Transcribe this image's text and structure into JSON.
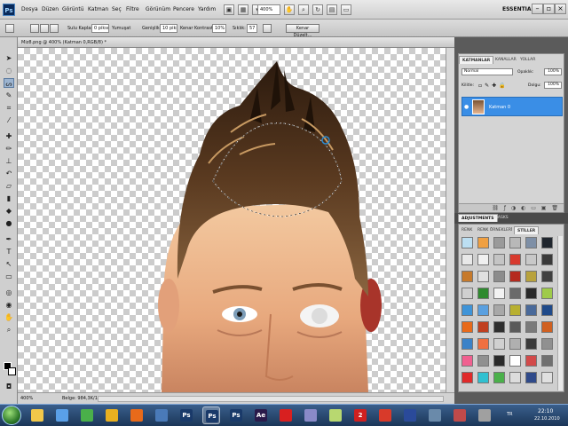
{
  "menubar": {
    "logo": "Ps",
    "items": [
      "Dosya",
      "Düzen",
      "Görüntü",
      "Katman",
      "Seç",
      "Filtre",
      "Görünüm",
      "Pencere",
      "Yardım"
    ],
    "zoom": "400%",
    "workspace": "ESSENTIALS"
  },
  "options": {
    "feather_label": "Sulu Kaplan:",
    "feather_value": "0 piksel",
    "antialias_label": "Yumuşat",
    "width_label": "Genişlik:",
    "width_value": "10 piksel",
    "contrast_label": "Kenar Kontrastı:",
    "contrast_value": "10%",
    "freq_label": "Sıklık:",
    "freq_value": "57",
    "refine_label": "Kenar Düzelt..."
  },
  "document": {
    "tab_title": "Miz8.png @ 400% (Katman 0,RGB/8) *",
    "zoom_status": "400%",
    "doc_size": "Belge: 984,3K/1,28M"
  },
  "layers": {
    "tabs": [
      "KATMANLAR",
      "KANALLAR",
      "YOLLAR"
    ],
    "blend_mode": "Normal",
    "opacity_label": "Opaklık:",
    "opacity_value": "100%",
    "lock_label": "Kilitle:",
    "fill_label": "Dolgu:",
    "fill_value": "100%",
    "layer_name": "Katman 0"
  },
  "adjustments": {
    "tabs": [
      "ADJUSTMENTS",
      "MASKS"
    ]
  },
  "styles": {
    "tabs": [
      "RENK",
      "RENK ÖRNEKLERİ",
      "STİLLER"
    ],
    "colors": [
      "#bcdff2",
      "#f0a042",
      "#9a9a9a",
      "#b8b8b8",
      "#7e8fa6",
      "#20262e",
      "#e8e8e8",
      "#f0f0f0",
      "#c4c4c4",
      "#d83a2e",
      "#c8c8c8",
      "#3a3a3a",
      "#c77a2b",
      "#e0e0e0",
      "#8c8c8c",
      "#b52a1e",
      "#b8a23c",
      "#404040",
      "#d0d0d0",
      "#2f8a2f",
      "#f2f2f2",
      "#6a6a6a",
      "#2a2a2a",
      "#9fcb4a",
      "#3f94d8",
      "#5aa0e0",
      "#a8a8a8",
      "#b8b030",
      "#4a6a9a",
      "#1f4a8a",
      "#e86a1a",
      "#c04020",
      "#2f2f2f",
      "#5a5a5a",
      "#7a7a7a",
      "#d06020",
      "#3a82c8",
      "#f07040",
      "#d0d0d0",
      "#b0b0b0",
      "#3a3a3a",
      "#909090",
      "#f06090",
      "#909090",
      "#2a2a2a",
      "#ffffff",
      "#d24a4a",
      "#707070",
      "#e02a2a",
      "#30c0d0",
      "#4ab04a",
      "#dcdcdc",
      "#2f4a8a",
      "#e0e0e0"
    ]
  },
  "taskbar": {
    "items": [
      {
        "label": "",
        "color": "#f1c84a"
      },
      {
        "label": "",
        "color": "#5aa0e8"
      },
      {
        "label": "",
        "color": "#4ab04a"
      },
      {
        "label": "",
        "color": "#e8b020"
      },
      {
        "label": "",
        "color": "#e86a1a"
      },
      {
        "label": "",
        "color": "#4a7ab8"
      },
      {
        "label": "Ps",
        "color": "#1a3a6a"
      },
      {
        "label": "Ps",
        "color": "#1a3a6a"
      },
      {
        "label": "Ps",
        "color": "#1a3a6a"
      },
      {
        "label": "Ae",
        "color": "#2a1a4a"
      },
      {
        "label": "",
        "color": "#d82020"
      },
      {
        "label": "",
        "color": "#8a8ac8"
      },
      {
        "label": "",
        "color": "#b8d870"
      },
      {
        "label": "2",
        "color": "#d02020"
      },
      {
        "label": "",
        "color": "#d83a2a"
      },
      {
        "label": "",
        "color": "#2a4a9a"
      },
      {
        "label": "",
        "color": "#6a8aaa"
      },
      {
        "label": "",
        "color": "#c04a4a"
      },
      {
        "label": "",
        "color": "#a0a0a0"
      }
    ],
    "lang": "TR",
    "time": "22:10",
    "date": "22.10.2010"
  }
}
